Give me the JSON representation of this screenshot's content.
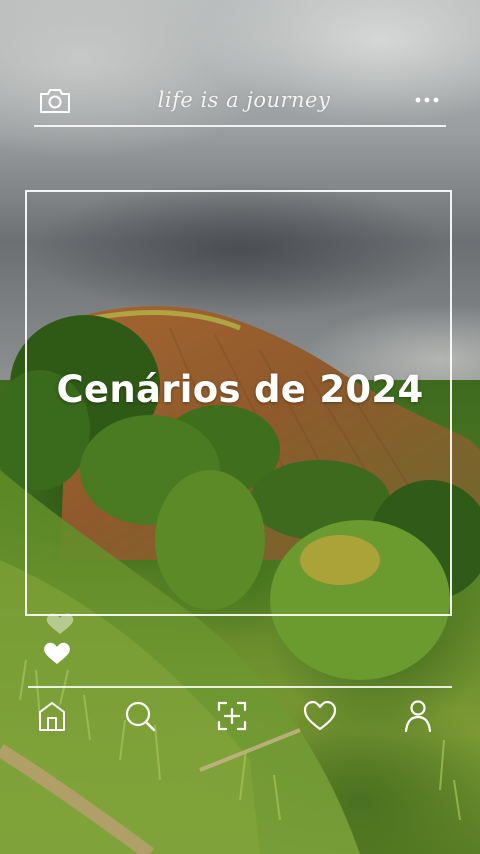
{
  "header": {
    "title": "life is a journey",
    "camera_icon": "camera-icon",
    "more_icon": "more-horizontal-icon"
  },
  "post": {
    "headline": "Cenários de 2024",
    "liked": true,
    "like_icon": "heart-icon"
  },
  "bottom_nav": {
    "items": [
      {
        "icon": "home-icon"
      },
      {
        "icon": "search-icon"
      },
      {
        "icon": "add-post-icon"
      },
      {
        "icon": "heart-icon"
      },
      {
        "icon": "profile-icon"
      }
    ]
  },
  "colors": {
    "overlay_line": "#ffffff",
    "text": "#ffffff"
  }
}
